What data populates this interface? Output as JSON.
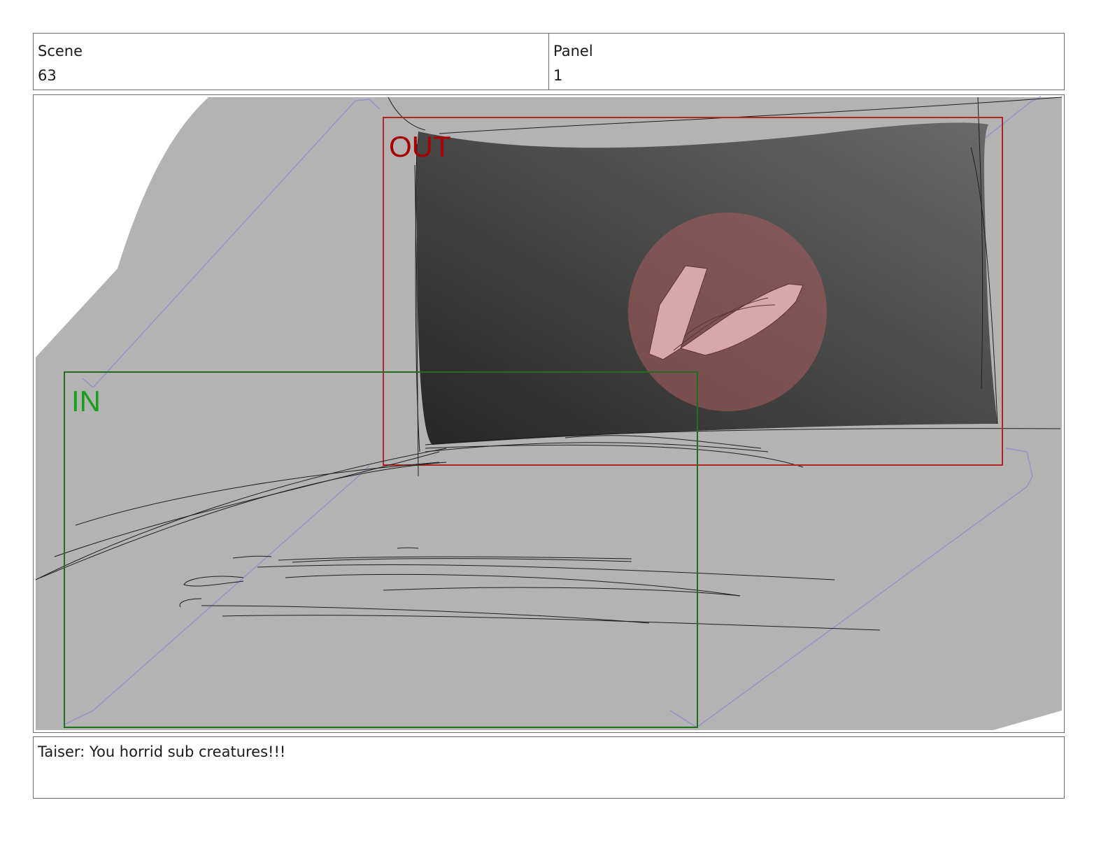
{
  "header": {
    "scene_label": "Scene",
    "scene_value": "63",
    "panel_label": "Panel",
    "panel_value": "1"
  },
  "frame": {
    "out_label": "OUT",
    "in_label": "IN",
    "colors": {
      "out_frame": "#b32424",
      "in_frame": "#1f6e1f",
      "out_text": "#a80000",
      "in_text": "#18a018",
      "background_shape": "#b3b3b3",
      "screen_dark": "#2e2e2e",
      "screen_light": "#6a6a6a",
      "highlight_circle": "#a05a5a",
      "guide_line": "#8c8cd0"
    }
  },
  "caption": {
    "dialogue": "Taiser: You horrid sub creatures!!!"
  }
}
